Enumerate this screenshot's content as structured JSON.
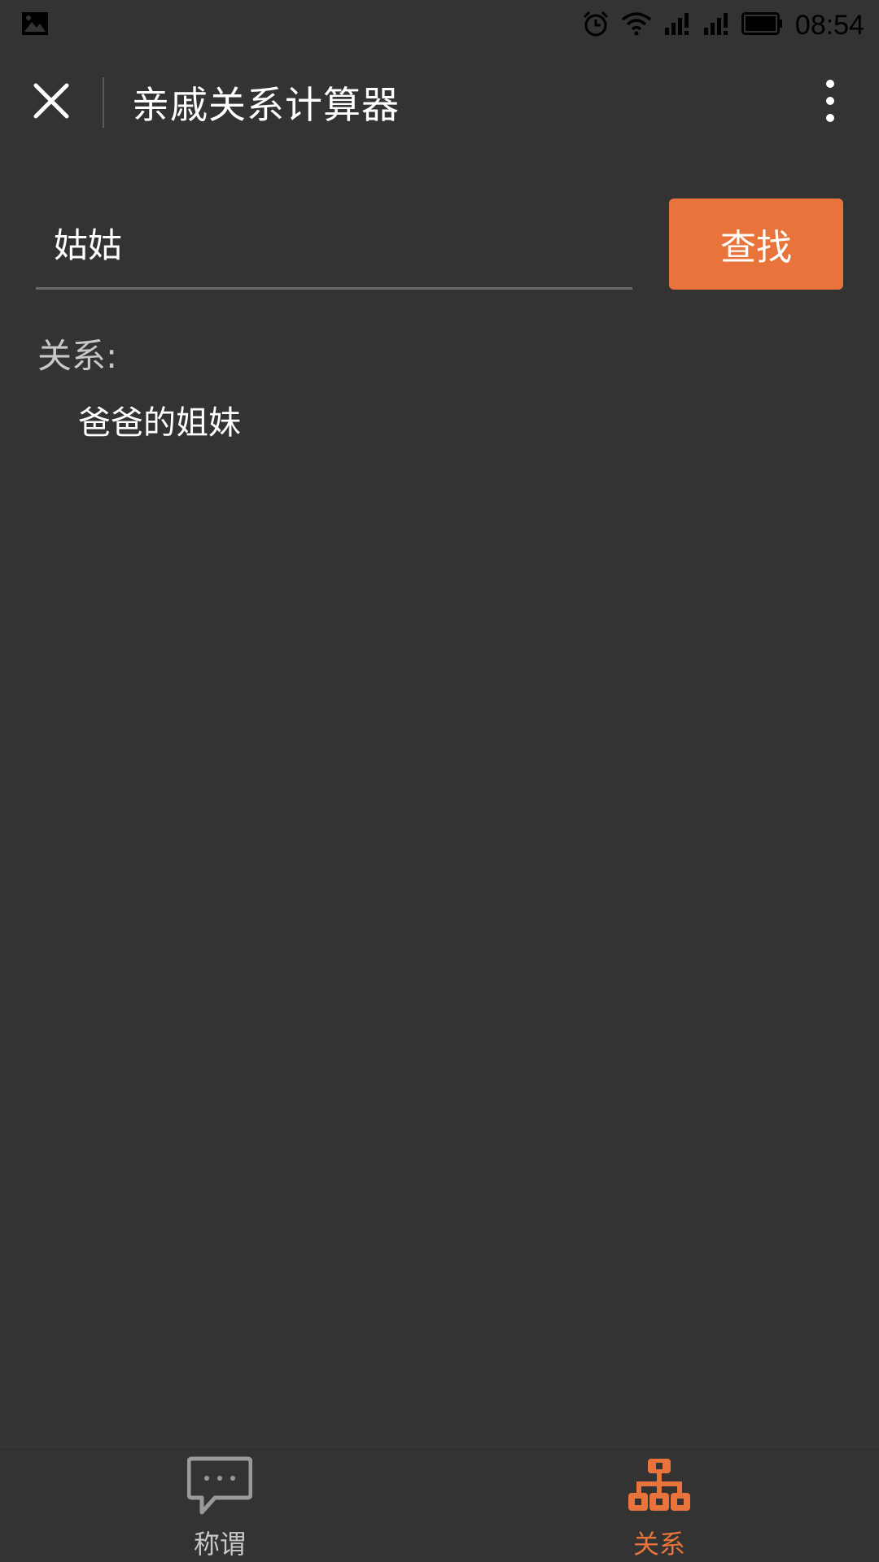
{
  "status_bar": {
    "left_icon": "image-icon",
    "icons": [
      "alarm-icon",
      "wifi-icon",
      "signal-icon",
      "signal-icon",
      "battery-icon"
    ],
    "time": "08:54"
  },
  "title_bar": {
    "title": "亲戚关系计算器",
    "close_icon": "close-icon",
    "more_icon": "more-vertical-icon"
  },
  "search": {
    "value": "姑姑",
    "button_label": "查找"
  },
  "result": {
    "label": "关系:",
    "value": "爸爸的姐妹"
  },
  "tabs": [
    {
      "label": "称谓",
      "icon": "chat-bubble-icon",
      "active": false
    },
    {
      "label": "关系",
      "icon": "hierarchy-icon",
      "active": true
    }
  ],
  "colors": {
    "background": "#333333",
    "accent": "#e8743b",
    "text": "#ffffff",
    "muted": "#c8c8c8"
  }
}
